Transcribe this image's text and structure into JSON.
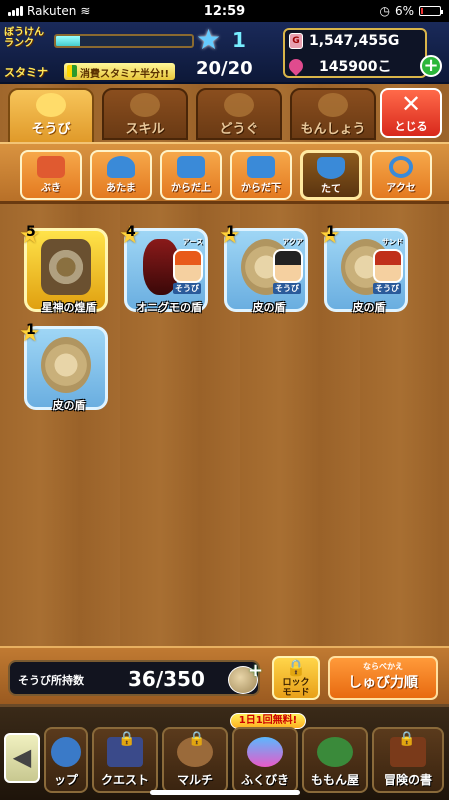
{
  "status_bar": {
    "carrier": "Rakuten",
    "time": "12:59",
    "battery": "6%"
  },
  "hud": {
    "rank_label": "ぼうけんランク",
    "rank_level": "1",
    "stamina_label": "スタミナ",
    "stamina_badge": "消費スタミナ半分!!",
    "stamina_value": "20/20",
    "gold": "1,547,455G",
    "gems": "145900こ"
  },
  "tabs": [
    {
      "label": "そうび",
      "active": true
    },
    {
      "label": "スキル",
      "active": false
    },
    {
      "label": "どうぐ",
      "active": false
    },
    {
      "label": "もんしょう",
      "active": false
    }
  ],
  "close_label": "とじる",
  "categories": [
    {
      "label": "ぶき",
      "icon": "sword-icon",
      "color": "#e05a30"
    },
    {
      "label": "あたま",
      "icon": "helmet-icon",
      "color": "#3a8ad8"
    },
    {
      "label": "からだ上",
      "icon": "armor-top-icon",
      "color": "#3a8ad8"
    },
    {
      "label": "からだ下",
      "icon": "armor-bottom-icon",
      "color": "#3a8ad8"
    },
    {
      "label": "たて",
      "icon": "shield-icon",
      "color": "#3a8ad8",
      "active": true
    },
    {
      "label": "アクセ",
      "icon": "ring-icon",
      "color": "#3a8ad8"
    }
  ],
  "items": [
    {
      "name": "星神の煌盾",
      "stars": "5",
      "style": "gold",
      "owner": "",
      "equipped": false
    },
    {
      "name": "オニグモの盾",
      "stars": "4",
      "style": "dark",
      "owner": "アース",
      "equipped": true,
      "hair": "#e85a1a"
    },
    {
      "name": "皮の盾",
      "stars": "1",
      "style": "blue",
      "owner": "アクア",
      "equipped": true,
      "hair": "#222"
    },
    {
      "name": "皮の盾",
      "stars": "1",
      "style": "blue",
      "owner": "サンド",
      "equipped": true,
      "hair": "#c0301a"
    },
    {
      "name": "皮の盾",
      "stars": "1",
      "style": "blue",
      "owner": "",
      "equipped": false
    }
  ],
  "equipped_label": "そうび",
  "footer": {
    "count_label": "そうび所持数",
    "count_value": "36/350",
    "lock_label_1": "ロック",
    "lock_label_2": "モード",
    "sort_sub": "ならべかえ",
    "sort_main": "しゅび力順"
  },
  "nav": {
    "free_badge": "1日1回無料!",
    "items": [
      {
        "label": "ップ",
        "locked": false
      },
      {
        "label": "クエスト",
        "locked": true
      },
      {
        "label": "マルチ",
        "locked": true
      },
      {
        "label": "ふくびき",
        "locked": false
      },
      {
        "label": "ももん屋",
        "locked": false
      },
      {
        "label": "冒険の書",
        "locked": true
      }
    ]
  }
}
